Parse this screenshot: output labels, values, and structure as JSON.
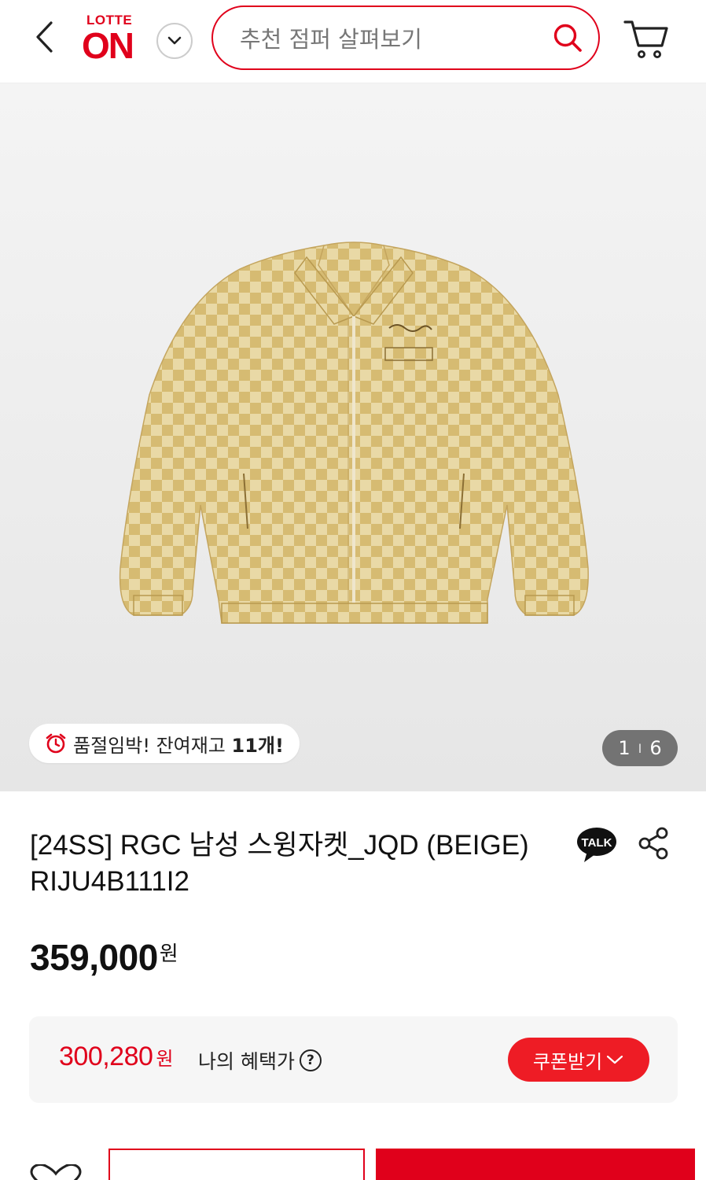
{
  "header": {
    "logo_top": "LOTTE",
    "logo_main": "ON",
    "search_placeholder": "추천 점퍼 살펴보기"
  },
  "gallery": {
    "stock_text": "품절임박! 잔여재고 ",
    "stock_count": "11개!",
    "current_page": "1",
    "separator": "I",
    "total_pages": "6"
  },
  "product": {
    "title": "[24SS] RGC 남성 스윙자켓_JQD (BEIGE) RIJU4B111I2",
    "talk_label": "TALK",
    "price": "359,000",
    "price_unit": "원"
  },
  "benefit": {
    "price": "300,280",
    "unit": "원",
    "label": "나의 혜택가",
    "help": "?",
    "coupon_button": "쿠폰받기"
  },
  "colors": {
    "brand_red": "#e0001b",
    "coupon_red": "#ee1c25",
    "jacket_beige": "#d9c07a"
  },
  "icons": [
    "back-arrow-icon",
    "chevron-down-icon",
    "search-icon",
    "cart-icon",
    "alarm-clock-icon",
    "kakao-talk-icon",
    "share-icon",
    "help-icon",
    "heart-icon"
  ]
}
